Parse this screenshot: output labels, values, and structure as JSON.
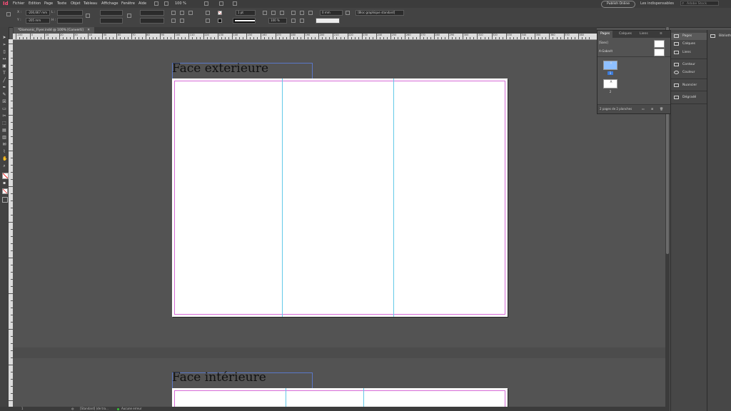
{
  "app": {
    "logo": "Id",
    "brand_color": "#ff3366"
  },
  "menubar": {
    "items": [
      "Fichier",
      "Edition",
      "Page",
      "Texte",
      "Objet",
      "Tableau",
      "Affichage",
      "Fenêtre",
      "Aide"
    ],
    "zoom": "100 %",
    "publish_label": "Publish Online",
    "workspace_label": "Les indispensables",
    "search_placeholder": "Adobe Stock"
  },
  "control": {
    "x_label": "X :",
    "x_value": "-200,667 mm",
    "y_label": "Y :",
    "y_value": "-205 mm",
    "w_label": "L :",
    "h_label": "H :",
    "stroke_weight": "1 pt",
    "scale_value": "100 %",
    "offset_value": "0 mm",
    "object_style": "[Bloc graphique standard]"
  },
  "document": {
    "tab_label": "*Diamonic_Flyer.indd @ 100% [Converti]"
  },
  "ruler": {
    "labels": [
      "-100",
      "0",
      "10",
      "20",
      "30",
      "40",
      "50",
      "60",
      "70",
      "80",
      "90",
      "100",
      "110",
      "120",
      "130",
      "140",
      "150",
      "160",
      "170",
      "180",
      "190",
      "200",
      "210",
      "220",
      "230",
      "240",
      "250",
      "260",
      "270",
      "280",
      "290",
      "300",
      "310",
      "320",
      "330",
      "340",
      "350",
      "360",
      "370",
      "380"
    ]
  },
  "spreads": [
    {
      "title": "Face exterieure"
    },
    {
      "title": "Face intérieure"
    }
  ],
  "pages_panel": {
    "tabs": [
      "Pages",
      "Calques",
      "Liens"
    ],
    "masters": [
      "[Sans]",
      "A-Gabarit"
    ],
    "pages": [
      {
        "number": "1",
        "master_letter": "A",
        "selected": true
      },
      {
        "number": "2",
        "master_letter": "A",
        "selected": false
      }
    ],
    "footer": "2 pages de 2 planches"
  },
  "dock": {
    "items": [
      "Pages",
      "Calques",
      "Liens",
      "Contour",
      "Couleur",
      "Nuancier",
      "Dégradé"
    ],
    "secondary": [
      "Bibliothèque"
    ]
  },
  "status": {
    "page": "1",
    "style": "[Standard] (de tra...",
    "errors": "Aucune erreur"
  }
}
